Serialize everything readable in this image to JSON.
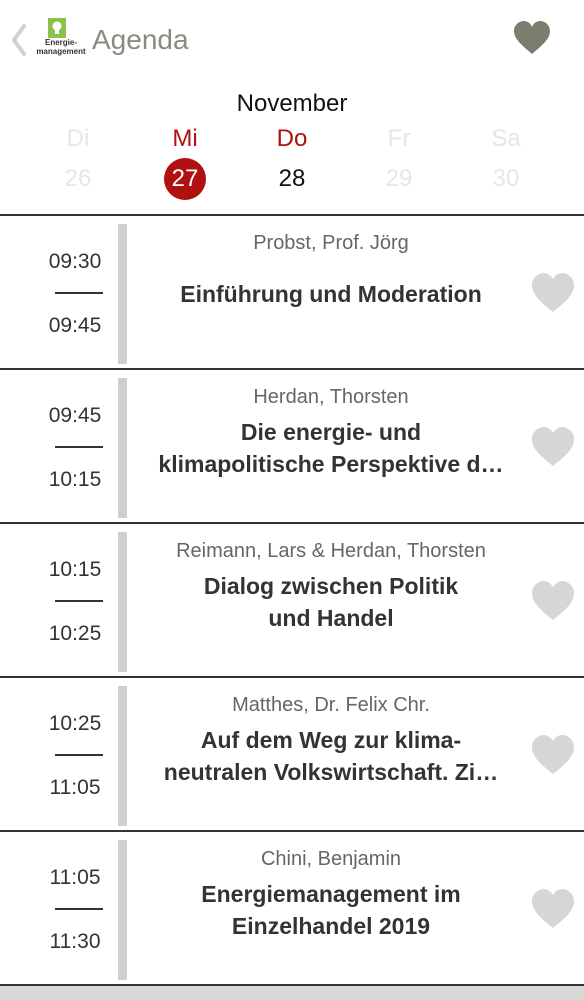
{
  "header": {
    "title": "Agenda",
    "logo_text_line1": "Energie-",
    "logo_text_line2": "management",
    "back_icon": "chevron-left-icon",
    "favorite_icon": "heart-icon"
  },
  "calendar": {
    "month": "November",
    "days": [
      {
        "name": "Di",
        "number": "26",
        "state": "muted"
      },
      {
        "name": "Mi",
        "number": "27",
        "state": "active"
      },
      {
        "name": "Do",
        "number": "28",
        "state": "today"
      },
      {
        "name": "Fr",
        "number": "29",
        "state": "muted"
      },
      {
        "name": "Sa",
        "number": "30",
        "state": "muted"
      }
    ]
  },
  "sessions": [
    {
      "start": "09:30",
      "end": "09:45",
      "speaker": "Probst, Prof. Jörg",
      "title_lines": [
        "Einführung und Moderation"
      ]
    },
    {
      "start": "09:45",
      "end": "10:15",
      "speaker": "Herdan, Thorsten",
      "title_lines": [
        "Die energie- und",
        "klimapolitische Perspektive d…"
      ]
    },
    {
      "start": "10:15",
      "end": "10:25",
      "speaker": "Reimann, Lars & Herdan, Thorsten",
      "title_lines": [
        "Dialog zwischen Politik",
        "und Handel"
      ]
    },
    {
      "start": "10:25",
      "end": "11:05",
      "speaker": "Matthes, Dr. Felix Chr.",
      "title_lines": [
        "Auf dem Weg zur klima-",
        "neutralen Volkswirtschaft. Zi…"
      ]
    },
    {
      "start": "11:05",
      "end": "11:30",
      "speaker": "Chini, Benjamin",
      "title_lines": [
        "Energiemanagement im",
        "Einzelhandel 2019"
      ]
    }
  ],
  "colors": {
    "accent": "#b01010",
    "title_gray": "#8a8a7e",
    "heart_top": "#7d7d6f",
    "heart_item": "#d6d6d6"
  }
}
